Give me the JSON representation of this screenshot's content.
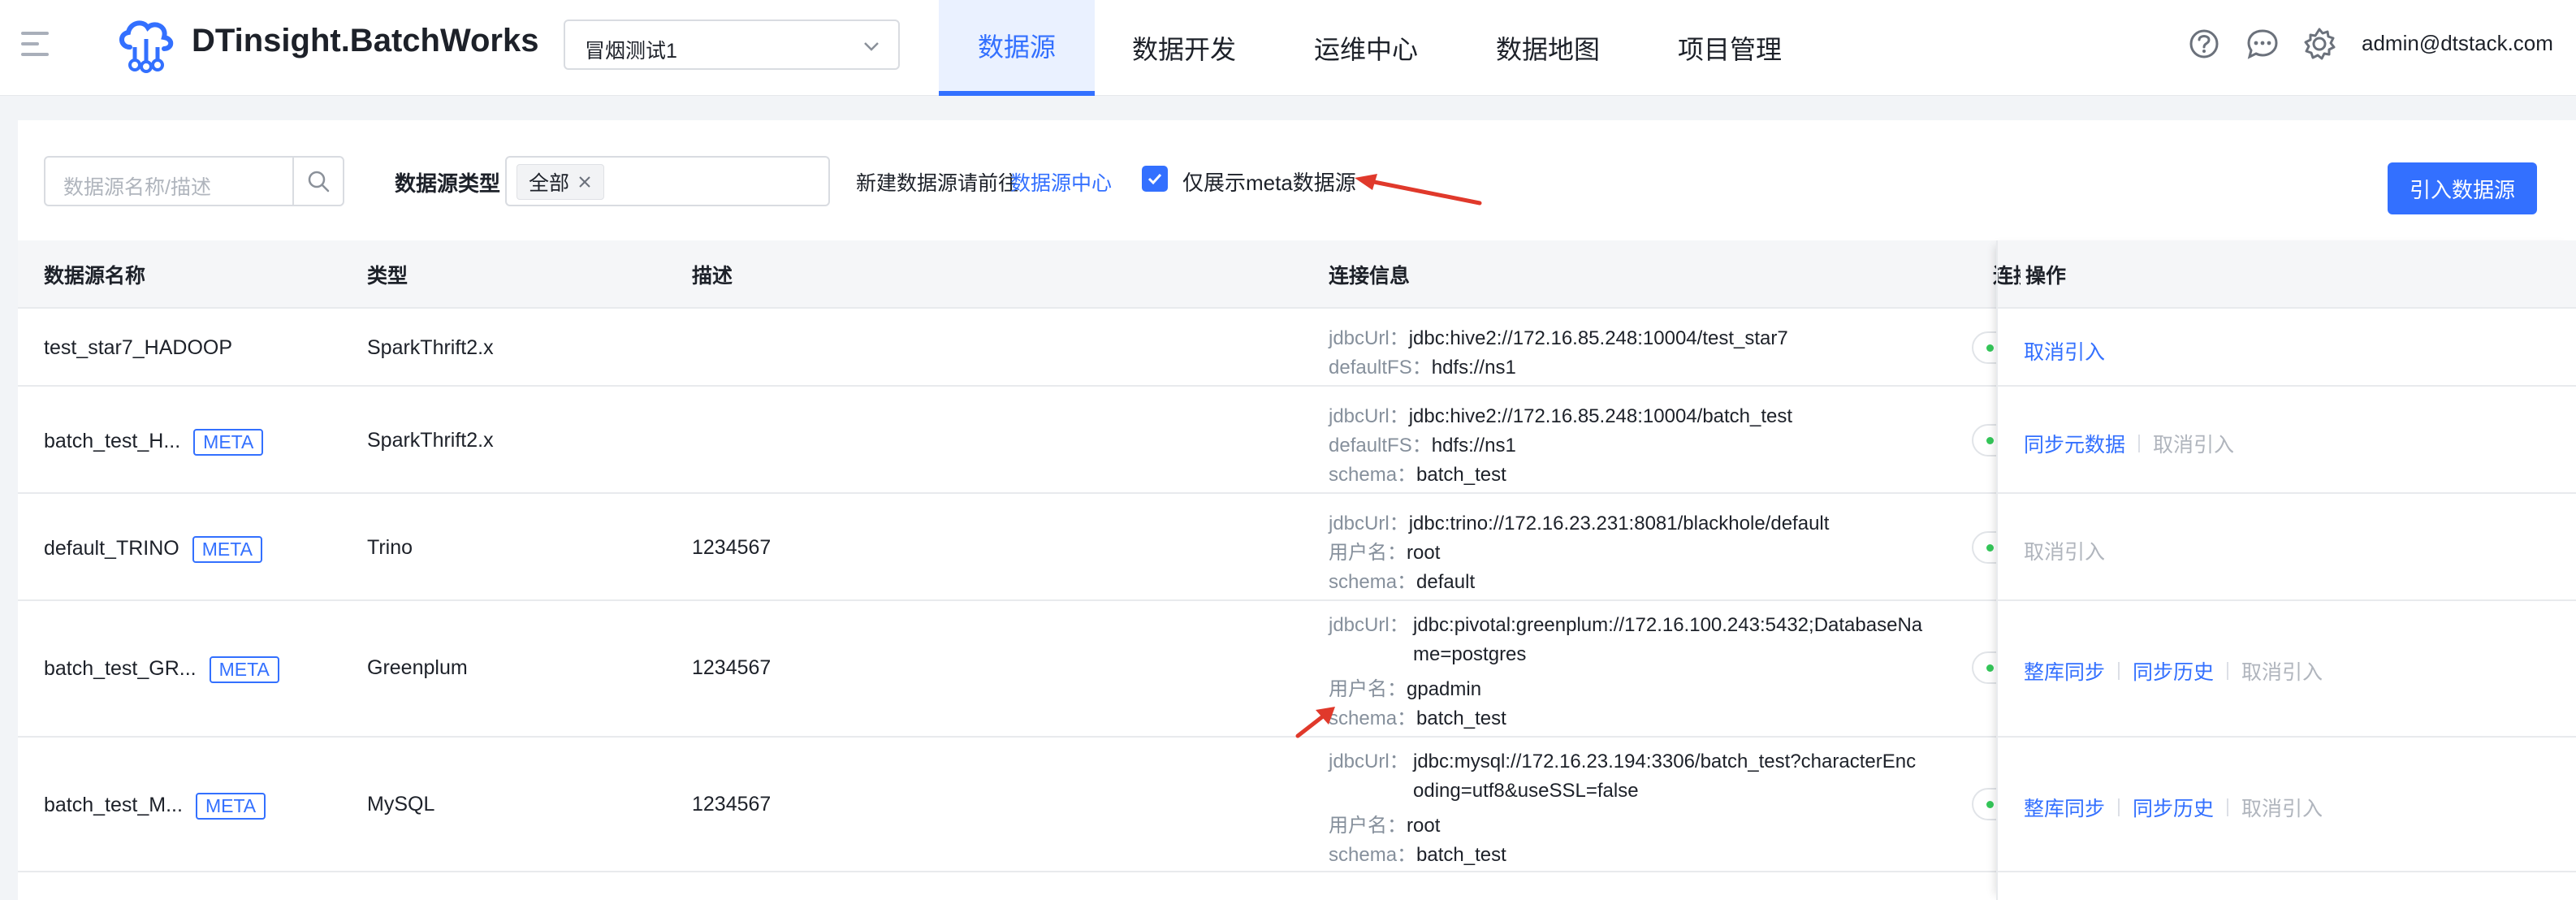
{
  "header": {
    "app_title": "DTinsight.BatchWorks",
    "project": "冒烟测试1",
    "nav": [
      "数据源",
      "数据开发",
      "运维中心",
      "数据地图",
      "项目管理"
    ],
    "user": "admin@dtstack.com",
    "icons": [
      "menu-icon",
      "cloud-logo-icon",
      "help-icon",
      "message-icon",
      "gear-icon"
    ]
  },
  "toolbar": {
    "search_placeholder": "数据源名称/描述",
    "type_label": "数据源类型",
    "type_tag": "全部",
    "hint": "新建数据源请前往",
    "hint_link": "数据源中心",
    "checkbox_label": "仅展示meta数据源",
    "checkbox_checked": true,
    "import_button": "引入数据源"
  },
  "table": {
    "headers": [
      "数据源名称",
      "类型",
      "描述",
      "连接信息",
      "连接",
      "操作"
    ],
    "rows": [
      {
        "name": "test_star7_HADOOP",
        "meta": "",
        "type": "SparkThrift2.x",
        "desc": "",
        "conn": [
          {
            "k": "jdbcUrl：",
            "v": "jdbc:hive2://172.16.85.248:10004/test_star7"
          },
          {
            "k": "defaultFS：",
            "v": "hdfs://ns1"
          }
        ],
        "ops": [
          {
            "label": "取消引入",
            "enabled": true
          }
        ]
      },
      {
        "name": "batch_test_H...",
        "meta": "META",
        "type": "SparkThrift2.x",
        "desc": "",
        "conn": [
          {
            "k": "jdbcUrl：",
            "v": "jdbc:hive2://172.16.85.248:10004/batch_test"
          },
          {
            "k": "defaultFS：",
            "v": "hdfs://ns1"
          },
          {
            "k": "schema：",
            "v": "batch_test"
          }
        ],
        "ops": [
          {
            "label": "同步元数据",
            "enabled": true
          },
          {
            "label": "取消引入",
            "enabled": false
          }
        ]
      },
      {
        "name": "default_TRINO",
        "meta": "META",
        "type": "Trino",
        "desc": "1234567",
        "conn": [
          {
            "k": "jdbcUrl：",
            "v": "jdbc:trino://172.16.23.231:8081/blackhole/default"
          },
          {
            "k": "用户名：",
            "v": "root"
          },
          {
            "k": "schema：",
            "v": "default"
          }
        ],
        "ops": [
          {
            "label": "取消引入",
            "enabled": false
          }
        ]
      },
      {
        "name": "batch_test_GR...",
        "meta": "META",
        "type": "Greenplum",
        "desc": "1234567",
        "conn": [
          {
            "k": "jdbcUrl：",
            "v": "jdbc:pivotal:greenplum://172.16.100.243:5432;DatabaseName=postgres"
          },
          {
            "k": "用户名：",
            "v": "gpadmin"
          },
          {
            "k": "schema：",
            "v": "batch_test"
          }
        ],
        "ops": [
          {
            "label": "整库同步",
            "enabled": true
          },
          {
            "label": "同步历史",
            "enabled": true
          },
          {
            "label": "取消引入",
            "enabled": false
          }
        ]
      },
      {
        "name": "batch_test_M...",
        "meta": "META",
        "type": "MySQL",
        "desc": "1234567",
        "conn": [
          {
            "k": "jdbcUrl：",
            "v": "jdbc:mysql://172.16.23.194:3306/batch_test?characterEncoding=utf8&useSSL=false"
          },
          {
            "k": "用户名：",
            "v": "root"
          },
          {
            "k": "schema：",
            "v": "batch_test"
          }
        ],
        "ops": [
          {
            "label": "整库同步",
            "enabled": true
          },
          {
            "label": "同步历史",
            "enabled": true
          },
          {
            "label": "取消引入",
            "enabled": false
          }
        ]
      }
    ]
  },
  "colors": {
    "accent": "#3370ff",
    "disabled": "#b0b5bd",
    "label_grey": "#86909c",
    "status_ok": "#34c759",
    "annotation_arrow": "#e0392b"
  }
}
